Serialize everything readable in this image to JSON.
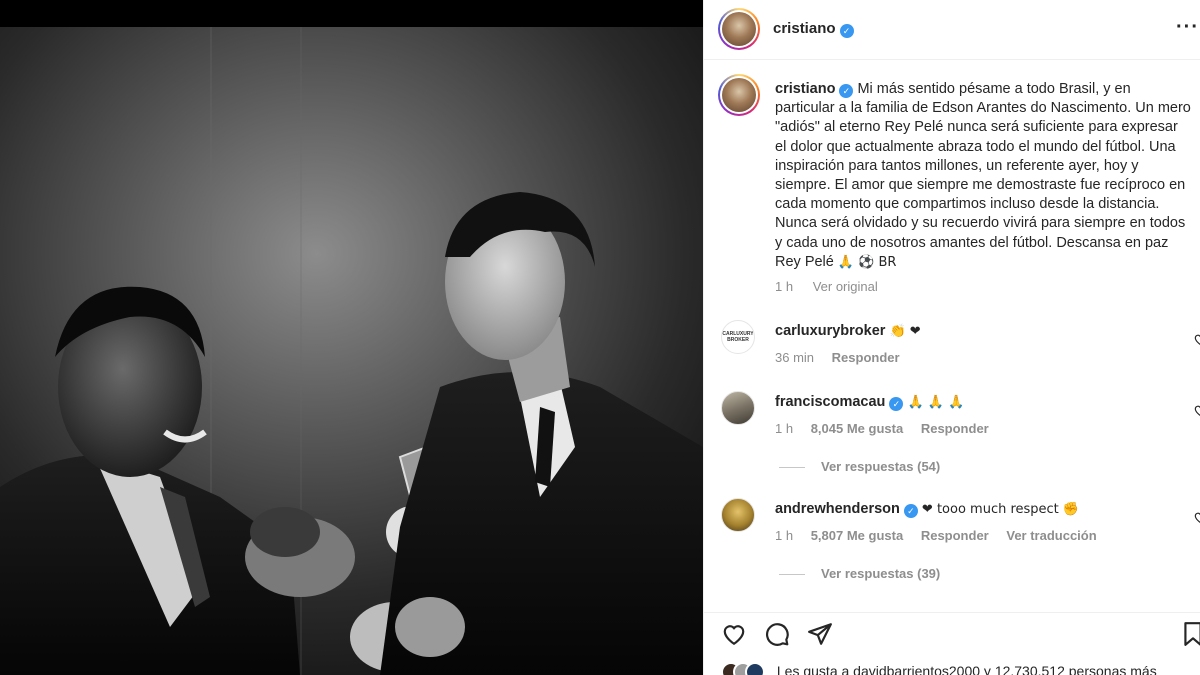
{
  "post": {
    "author": "cristiano",
    "verified_mark": "✓",
    "more_icon": "more-horizontal-icon"
  },
  "caption": {
    "username": "cristiano",
    "text": "Mi más sentido pésame a todo Brasil, y en particular a la familia de Edson Arantes do Nascimento. Un mero \"adiós\" al eterno Rey Pelé nunca será suficiente para expresar el dolor que actualmente abraza todo el mundo del fútbol. Una inspiración para tantos millones, un referente ayer, hoy y siempre. El amor que siempre me demostraste fue recíproco en cada momento que compartimos incluso desde la distancia. Nunca será olvidado y su recuerdo vivirá para siempre en todos y cada uno de nosotros amantes del fútbol. Descansa en paz Rey Pelé",
    "emoji_tail": "🙏 ⚽ BR",
    "time": "1 h",
    "see_original": "Ver original"
  },
  "comments": [
    {
      "username": "carluxurybroker",
      "verified": false,
      "text": "👏 ❤",
      "time": "36 min",
      "likes": "",
      "reply": "Responder",
      "translate": "",
      "avatar_text": "CARLUXURY BROKER"
    },
    {
      "username": "franciscomacau",
      "verified": true,
      "text": "🙏 🙏 🙏",
      "time": "1 h",
      "likes": "8,045 Me gusta",
      "reply": "Responder",
      "translate": "",
      "view_replies": "Ver respuestas (54)"
    },
    {
      "username": "andrewhenderson",
      "verified": true,
      "text": "❤ tooo much respect ✊",
      "time": "1 h",
      "likes": "5,807 Me gusta",
      "reply": "Responder",
      "translate": "Ver traducción",
      "view_replies": "Ver respuestas (39)"
    }
  ],
  "actions": [
    "heart-icon",
    "comment-icon",
    "share-icon",
    "bookmark-icon"
  ],
  "likes_summary": "Les gusta a davidbarrientos2000 y 12.730.512 personas más",
  "colors": {
    "verified": "#3897f0",
    "meta": "#8e8e8e",
    "text": "#262626",
    "heart": "#ed4956"
  }
}
